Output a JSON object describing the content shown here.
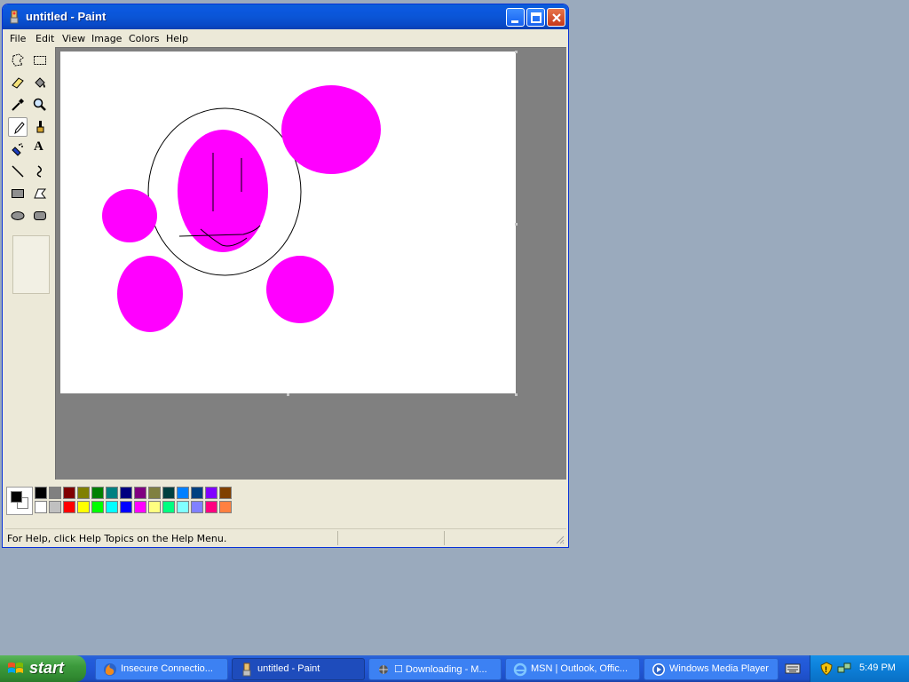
{
  "window": {
    "title": "untitled - Paint"
  },
  "menu": [
    "File",
    "Edit",
    "View",
    "Image",
    "Colors",
    "Help"
  ],
  "tools": [
    {
      "name": "free-form-select"
    },
    {
      "name": "select"
    },
    {
      "name": "eraser"
    },
    {
      "name": "fill-with-color"
    },
    {
      "name": "pick-color"
    },
    {
      "name": "magnifier"
    },
    {
      "name": "pencil",
      "active": true
    },
    {
      "name": "brush"
    },
    {
      "name": "airbrush"
    },
    {
      "name": "text"
    },
    {
      "name": "line"
    },
    {
      "name": "curve"
    },
    {
      "name": "rectangle"
    },
    {
      "name": "polygon"
    },
    {
      "name": "ellipse"
    },
    {
      "name": "rounded-rectangle"
    }
  ],
  "text_tool_glyph": "A",
  "palette": {
    "foreground": "#000000",
    "background": "#ffffff",
    "row1": [
      "#000000",
      "#808080",
      "#800000",
      "#808000",
      "#008000",
      "#008080",
      "#000080",
      "#800080",
      "#808040",
      "#004040",
      "#0080ff",
      "#004080",
      "#8000ff",
      "#804000"
    ],
    "row2": [
      "#ffffff",
      "#c0c0c0",
      "#ff0000",
      "#ffff00",
      "#00ff00",
      "#00ffff",
      "#0000ff",
      "#ff00ff",
      "#ffff80",
      "#00ff80",
      "#80ffff",
      "#8080ff",
      "#ff0080",
      "#ff8040"
    ]
  },
  "drawing": {
    "fill_color": "#ff00ff",
    "stroke_color": "#000000"
  },
  "status": {
    "help_text": "For Help, click Help Topics on the Help Menu."
  },
  "taskbar": {
    "start_label": "start",
    "items": [
      {
        "label": "Insecure Connectio...",
        "icon": "firefox-icon"
      },
      {
        "label": "untitled - Paint",
        "icon": "paint-icon",
        "active": true
      },
      {
        "label": "☐ Downloading - M...",
        "icon": "download-icon"
      },
      {
        "label": "MSN | Outlook, Offic...",
        "icon": "ie-icon"
      },
      {
        "label": "Windows Media Player",
        "icon": "media-player-icon"
      }
    ],
    "clock": "5:49 PM"
  }
}
